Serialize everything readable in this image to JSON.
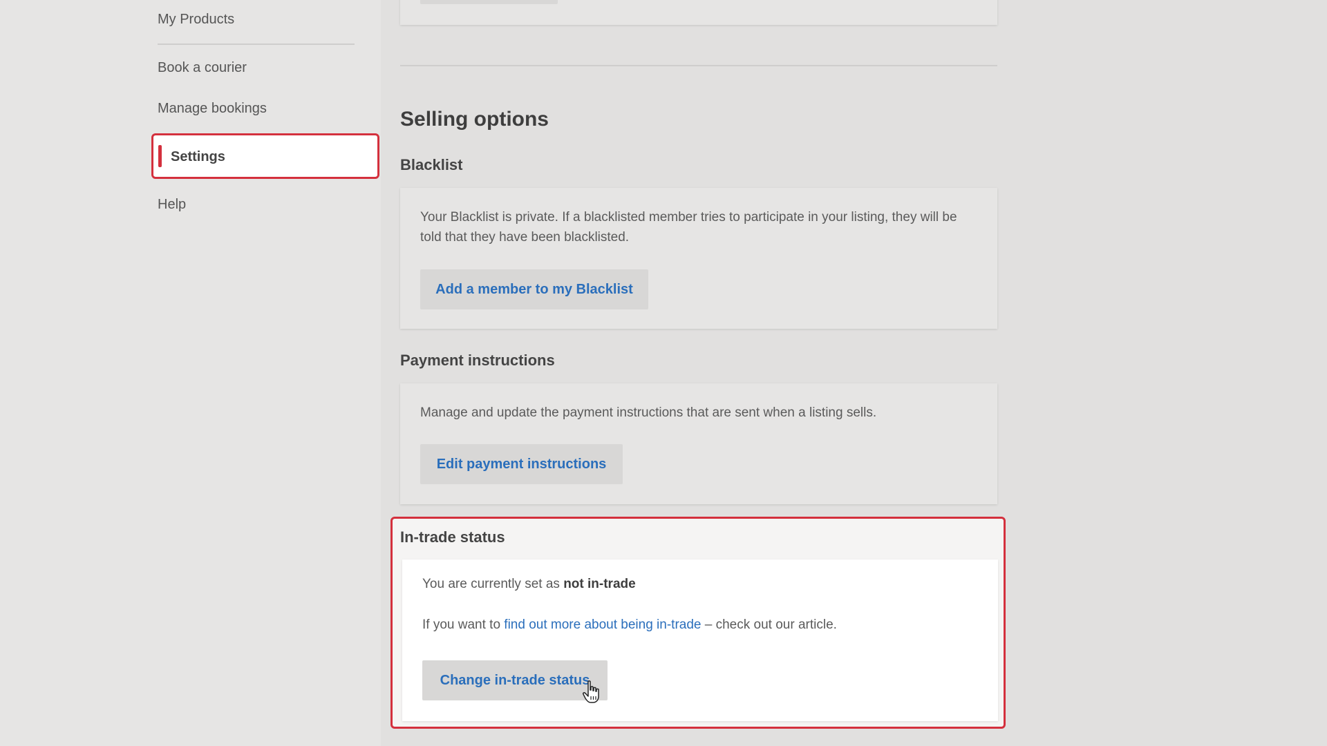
{
  "sidebar": {
    "items": [
      {
        "label": "My Products"
      },
      {
        "label": "Book a courier"
      },
      {
        "label": "Manage bookings"
      },
      {
        "label": "Settings"
      },
      {
        "label": "Help"
      }
    ]
  },
  "main": {
    "section_title": "Selling options",
    "blacklist": {
      "heading": "Blacklist",
      "text": "Your Blacklist is private. If a blacklisted member tries to participate in your listing, they will be told that they have been blacklisted.",
      "button": "Add a member to my Blacklist"
    },
    "payment": {
      "heading": "Payment instructions",
      "text": "Manage and update the payment instructions that are sent when a listing sells.",
      "button": "Edit payment instructions"
    },
    "intrade": {
      "heading": "In-trade status",
      "status_prefix": "You are currently set as ",
      "status_value": "not in-trade",
      "info_prefix": "If you want to ",
      "info_link": "find out more about being in-trade",
      "info_suffix": " – check out our article.",
      "button": "Change in-trade status"
    }
  },
  "colors": {
    "accent": "#d4303d",
    "link": "#2a6ebb"
  }
}
